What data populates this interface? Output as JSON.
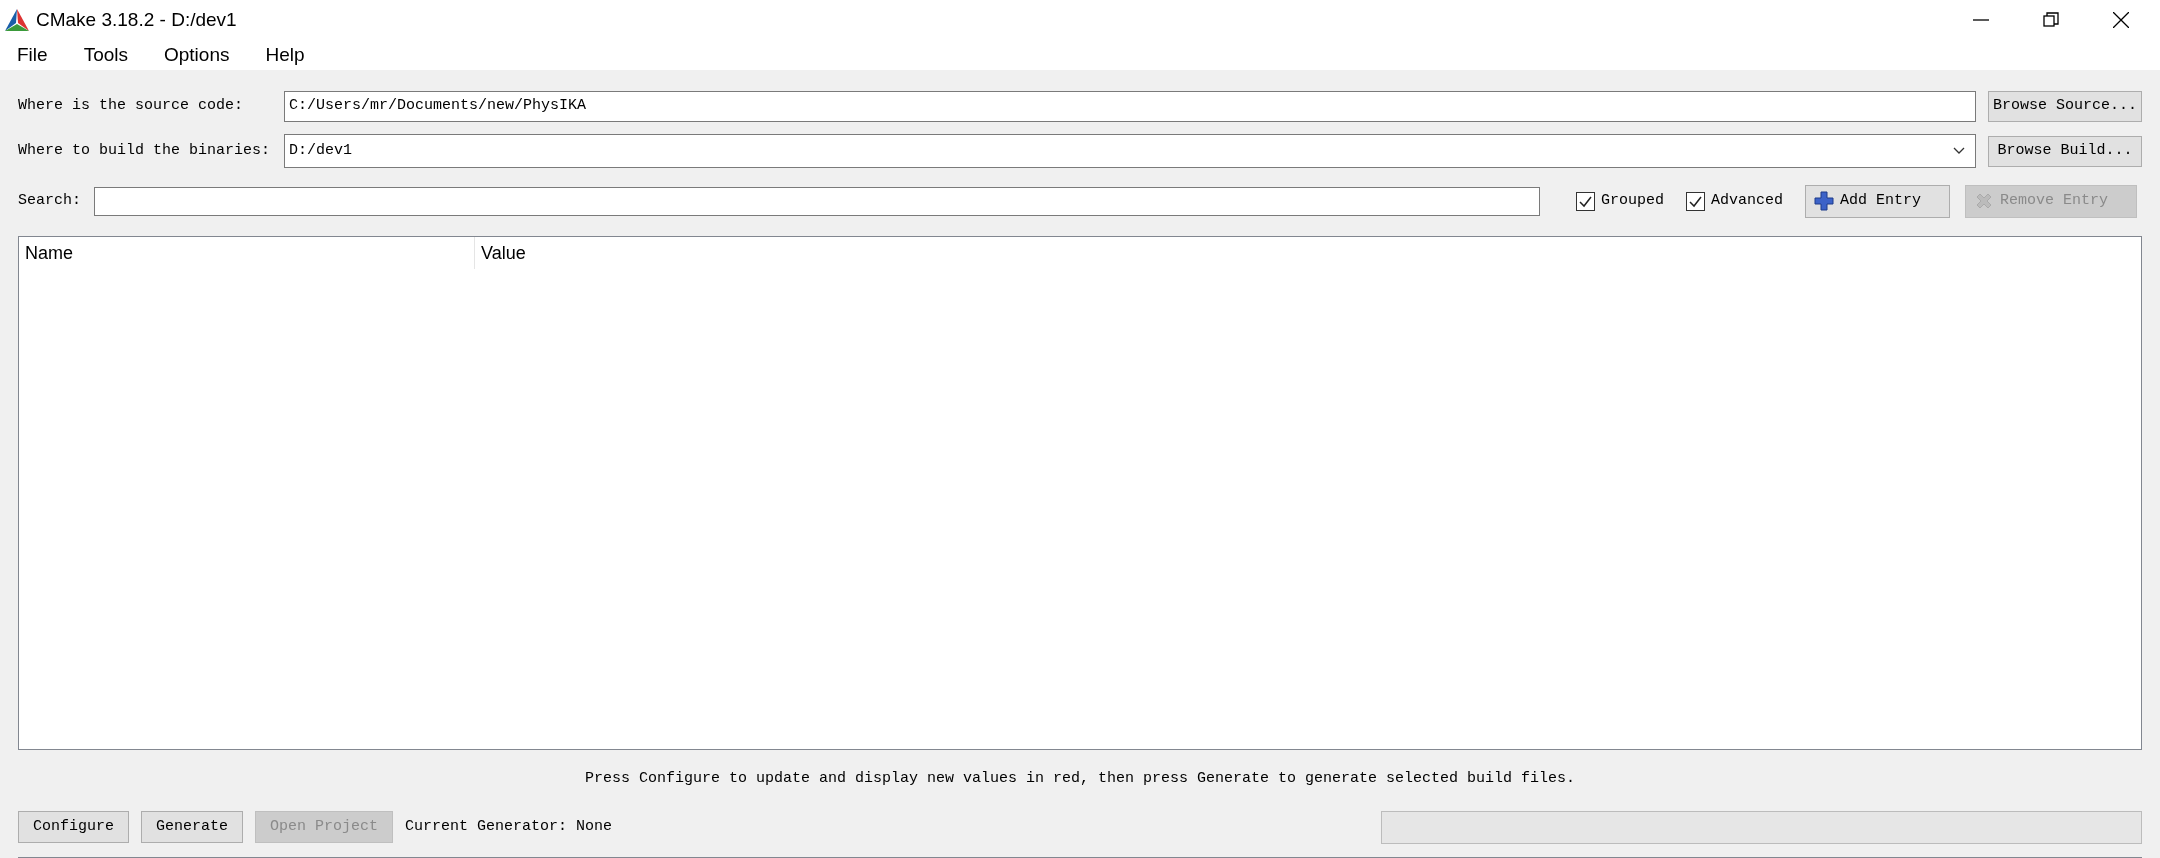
{
  "window": {
    "title": "CMake 3.18.2 - D:/dev1"
  },
  "menu": [
    "File",
    "Tools",
    "Options",
    "Help"
  ],
  "source": {
    "label": "Where is the source code:",
    "value": "C:/Users/mr/Documents/new/PhysIKA",
    "button": "Browse Source..."
  },
  "build": {
    "label": "Where to build the binaries:",
    "value": "D:/dev1",
    "button": "Browse Build..."
  },
  "search": {
    "label": "Search:"
  },
  "options": [
    {
      "label": "Grouped",
      "checked": true
    },
    {
      "label": "Advanced",
      "checked": true
    }
  ],
  "entry_buttons": [
    {
      "label": "Add Entry",
      "kind": "add",
      "disabled": false
    },
    {
      "label": "Remove Entry",
      "kind": "remove",
      "disabled": true
    }
  ],
  "table": {
    "columns": [
      "Name",
      "Value"
    ]
  },
  "message": "Press Configure to update and display new values in red, then press Generate to generate selected build files.",
  "actions": [
    {
      "label": "Configure",
      "disabled": false
    },
    {
      "label": "Generate",
      "disabled": false
    },
    {
      "label": "Open Project",
      "disabled": true
    }
  ],
  "generator": "Current Generator: None"
}
